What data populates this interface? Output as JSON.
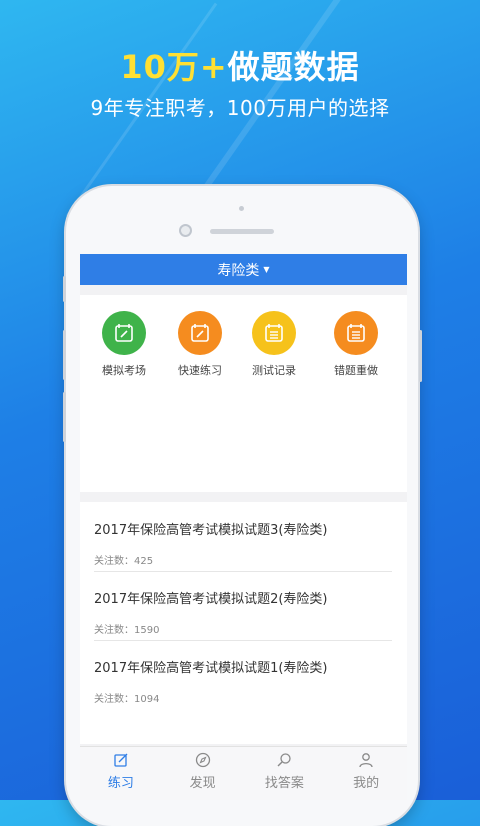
{
  "promo": {
    "headline_highlight": "10万+",
    "headline_rest": "做题数据",
    "subline": "9年专注职考，100万用户的选择"
  },
  "app": {
    "category": "寿险类",
    "menu": [
      {
        "label": "模拟考场",
        "icon": "pencil-note-icon",
        "color": "#3fb34a"
      },
      {
        "label": "快速练习",
        "icon": "pencil-note-icon",
        "color": "#f58c1f"
      },
      {
        "label": "测试记录",
        "icon": "list-note-icon",
        "color": "#f6c21b"
      },
      {
        "label": "错题重做",
        "icon": "list-note-icon",
        "color": "#f58c1f"
      }
    ],
    "papers": [
      {
        "title": "2017年保险高管考试模拟试题3(寿险类)",
        "follow": "关注数：425"
      },
      {
        "title": "2017年保险高管考试模拟试题2(寿险类)",
        "follow": "关注数：1590"
      },
      {
        "title": "2017年保险高管考试模拟试题1(寿险类)",
        "follow": "关注数：1094"
      }
    ],
    "tabs": [
      {
        "label": "练习",
        "icon": "edit-icon",
        "active": true
      },
      {
        "label": "发现",
        "icon": "compass-icon",
        "active": false
      },
      {
        "label": "找答案",
        "icon": "search-icon",
        "active": false
      },
      {
        "label": "我的",
        "icon": "user-icon",
        "active": false
      }
    ]
  },
  "colors": {
    "accent": "#2f7ee6",
    "highlight": "#ffe033"
  }
}
